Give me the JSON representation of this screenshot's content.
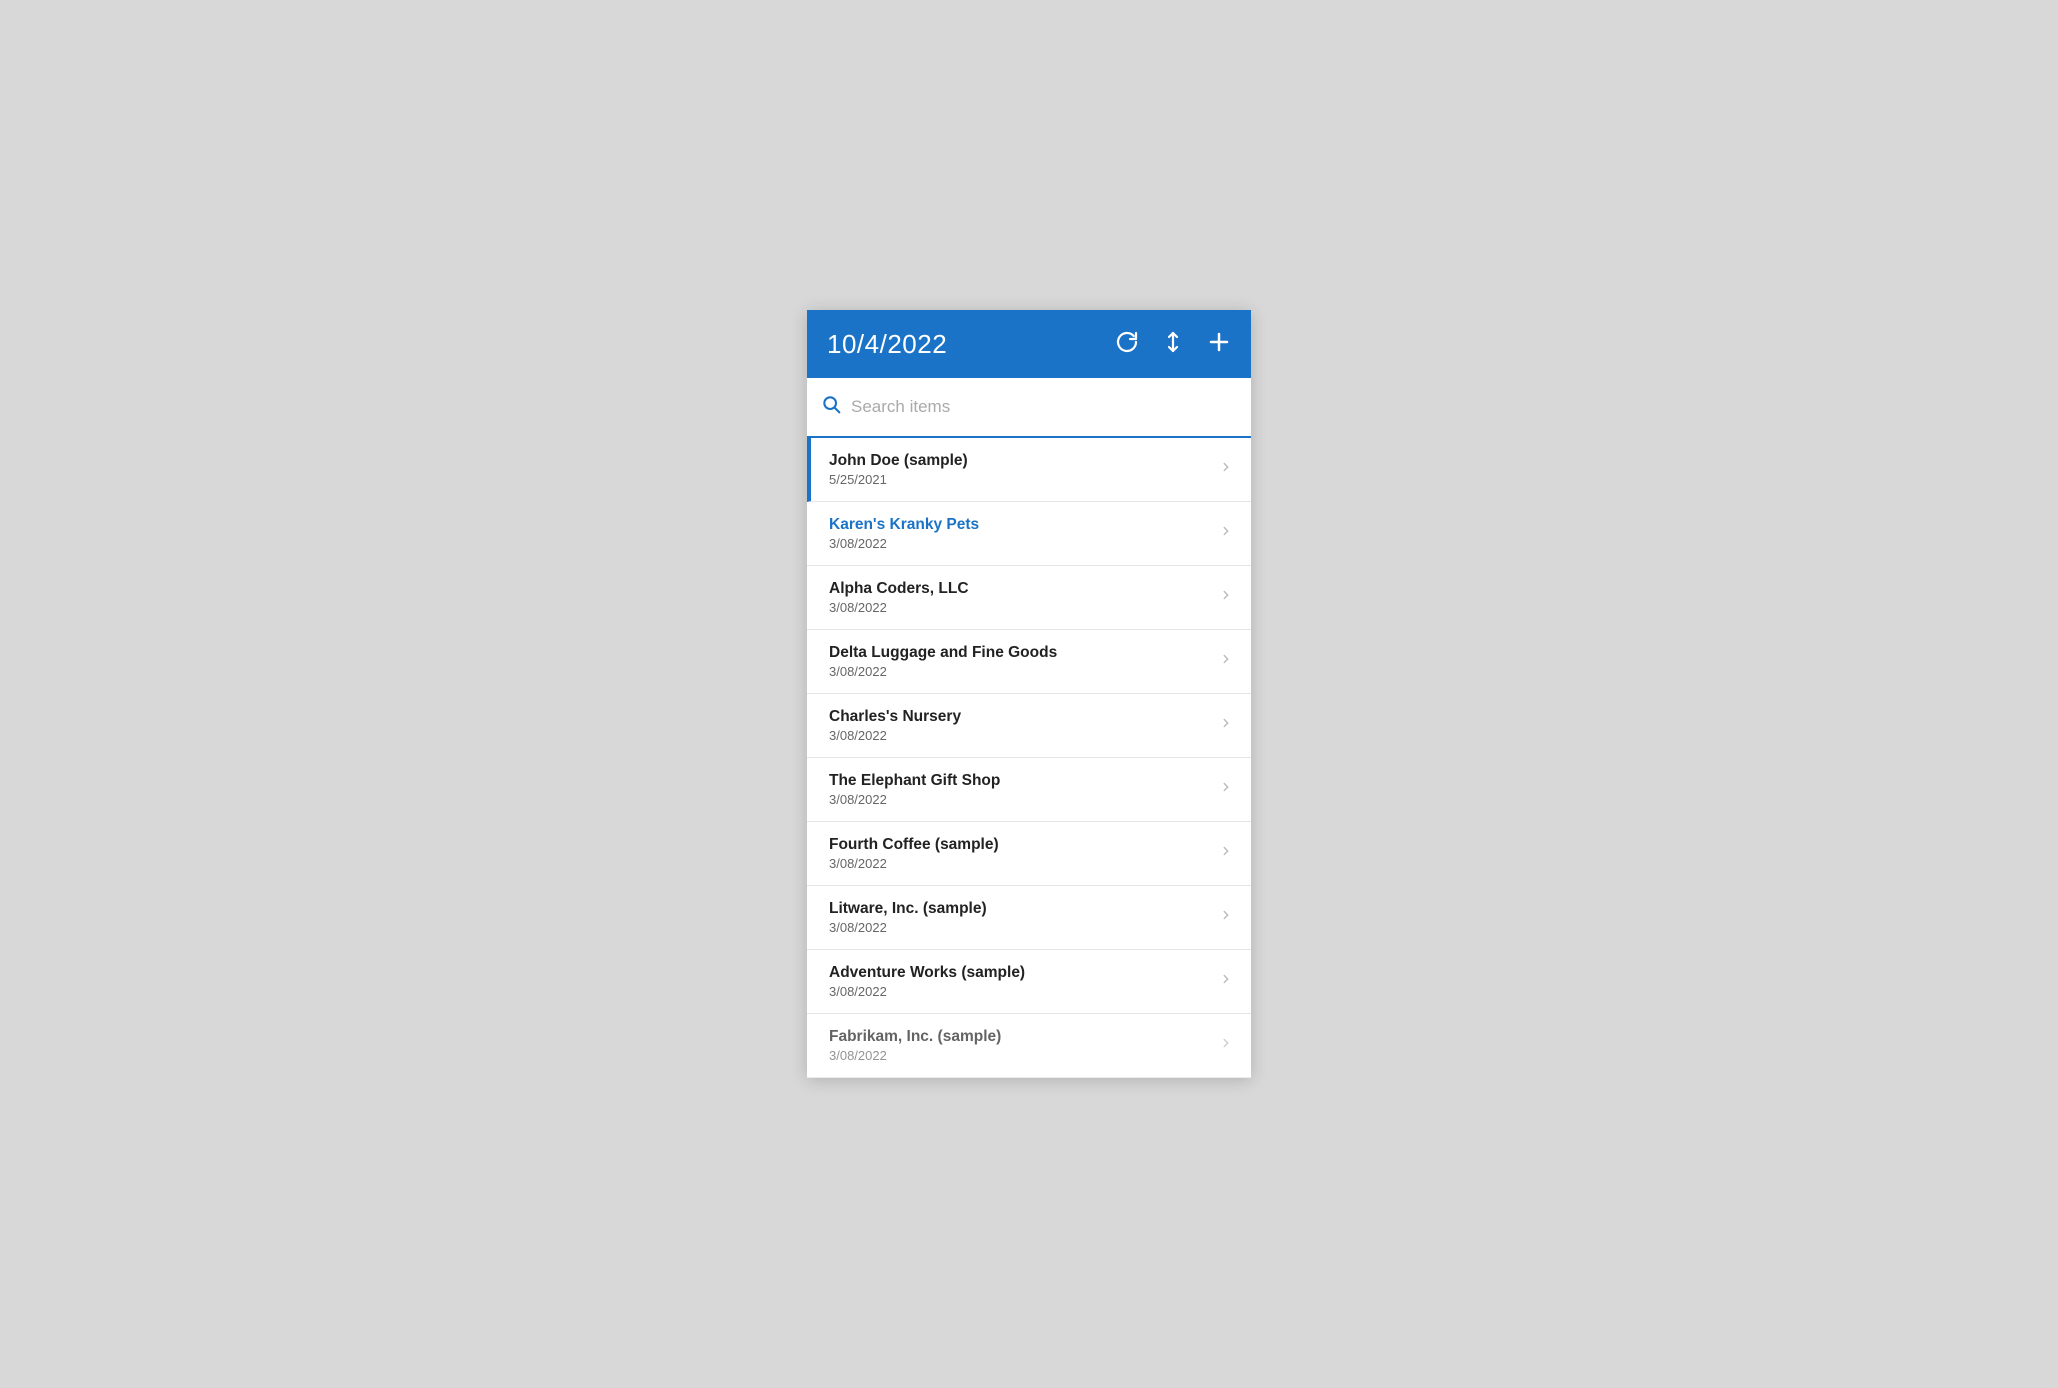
{
  "header": {
    "title": "10/4/2022",
    "actions": {
      "refresh_label": "↺",
      "sort_label": "⇅",
      "add_label": "+"
    }
  },
  "search": {
    "placeholder": "Search items"
  },
  "list": {
    "items": [
      {
        "id": 1,
        "name": "John Doe (sample)",
        "date": "5/25/2021",
        "highlighted": false,
        "selected": true
      },
      {
        "id": 2,
        "name": "Karen's Kranky Pets",
        "date": "3/08/2022",
        "highlighted": true,
        "selected": false
      },
      {
        "id": 3,
        "name": "Alpha Coders, LLC",
        "date": "3/08/2022",
        "highlighted": false,
        "selected": false
      },
      {
        "id": 4,
        "name": "Delta Luggage and Fine Goods",
        "date": "3/08/2022",
        "highlighted": false,
        "selected": false
      },
      {
        "id": 5,
        "name": "Charles's Nursery",
        "date": "3/08/2022",
        "highlighted": false,
        "selected": false
      },
      {
        "id": 6,
        "name": "The Elephant Gift Shop",
        "date": "3/08/2022",
        "highlighted": false,
        "selected": false
      },
      {
        "id": 7,
        "name": "Fourth Coffee (sample)",
        "date": "3/08/2022",
        "highlighted": false,
        "selected": false
      },
      {
        "id": 8,
        "name": "Litware, Inc. (sample)",
        "date": "3/08/2022",
        "highlighted": false,
        "selected": false
      },
      {
        "id": 9,
        "name": "Adventure Works (sample)",
        "date": "3/08/2022",
        "highlighted": false,
        "selected": false
      },
      {
        "id": 10,
        "name": "Fabrikam, Inc. (sample)",
        "date": "3/08/2022",
        "highlighted": false,
        "selected": false,
        "partial": true
      }
    ]
  },
  "colors": {
    "brand": "#1b73c7",
    "highlighted_text": "#1b73c7"
  }
}
